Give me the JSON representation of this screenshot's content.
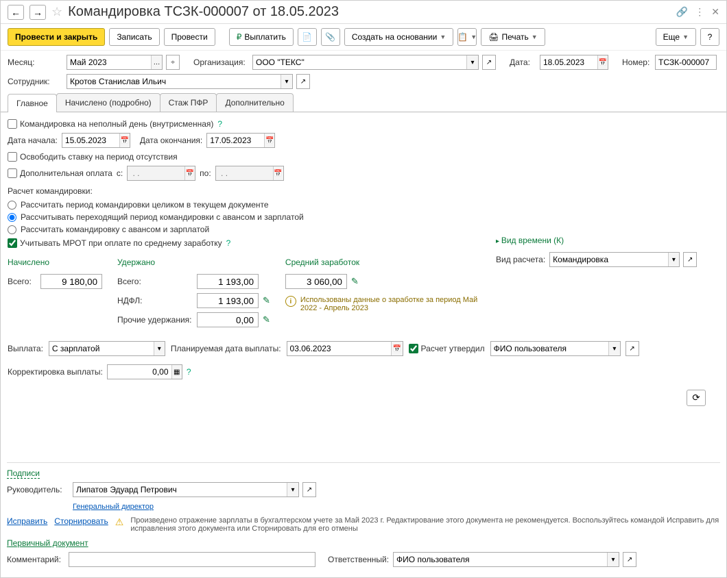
{
  "title": "Командировка ТСЗК-000007 от 18.05.2023",
  "toolbar": {
    "post_close": "Провести и закрыть",
    "write": "Записать",
    "post": "Провести",
    "pay": "Выплатить",
    "create_based": "Создать на основании",
    "print": "Печать",
    "more": "Еще"
  },
  "header": {
    "month_lbl": "Месяц:",
    "month_val": "Май 2023",
    "org_lbl": "Организация:",
    "org_val": "ООО \"ТЕКС\"",
    "date_lbl": "Дата:",
    "date_val": "18.05.2023",
    "num_lbl": "Номер:",
    "num_val": "ТСЗК-000007",
    "emp_lbl": "Сотрудник:",
    "emp_val": "Кротов Станислав Ильич"
  },
  "tabs": {
    "main": "Главное",
    "accrued": "Начислено (подробно)",
    "pfr": "Стаж ПФР",
    "extra": "Дополнительно"
  },
  "form": {
    "partial_day": "Командировка на неполный день (внутрисменная)",
    "start_lbl": "Дата начала:",
    "start_val": "15.05.2023",
    "end_lbl": "Дата окончания:",
    "end_val": "17.05.2023",
    "free_rate": "Освободить ставку на период отсутствия",
    "extra_pay": "Дополнительная оплата",
    "from": "с:",
    "to": "по:",
    "calc_header": "Расчет командировки:",
    "opt1": "Рассчитать период командировки целиком в текущем документе",
    "opt2": "Рассчитывать переходящий период командировки с авансом и зарплатой",
    "opt3": "Рассчитать командировку с авансом и зарплатой",
    "mrot": "Учитывать МРОТ при оплате по среднему заработку",
    "time_kind_link": "Вид времени (К)",
    "calc_type_lbl": "Вид расчета:",
    "calc_type_val": "Командировка"
  },
  "totals": {
    "accrued_title": "Начислено",
    "accrued_total_lbl": "Всего:",
    "accrued_total": "9 180,00",
    "withheld_title": "Удержано",
    "withheld_total_lbl": "Всего:",
    "withheld_total": "1 193,00",
    "ndfl_lbl": "НДФЛ:",
    "ndfl": "1 193,00",
    "other_lbl": "Прочие удержания:",
    "other": "0,00",
    "avg_title": "Средний заработок",
    "avg": "3 060,00",
    "info_text": "Использованы данные о заработке за период Май 2022 - Апрель 2023"
  },
  "payment": {
    "pay_lbl": "Выплата:",
    "pay_val": "С зарплатой",
    "plan_date_lbl": "Планируемая дата выплаты:",
    "plan_date_val": "03.06.2023",
    "approved_lbl": "Расчет утвердил",
    "approver": "ФИО пользователя",
    "correction_lbl": "Корректировка выплаты:",
    "correction_val": "0,00"
  },
  "signatures": {
    "link": "Подписи",
    "head_lbl": "Руководитель:",
    "head_val": "Липатов Эдуард Петрович",
    "position": "Генеральный директор"
  },
  "footer": {
    "fix": "Исправить",
    "reverse": "Сторнировать",
    "warn": "Произведено отражение зарплаты в бухгалтерском учете за Май 2023 г. Редактирование этого документа не рекомендуется. Воспользуйтесь командой Исправить для исправления этого документа или Сторнировать для его отмены",
    "primary_doc": "Первичный документ",
    "comment_lbl": "Комментарий:",
    "responsible_lbl": "Ответственный:",
    "responsible_val": "ФИО пользователя"
  }
}
